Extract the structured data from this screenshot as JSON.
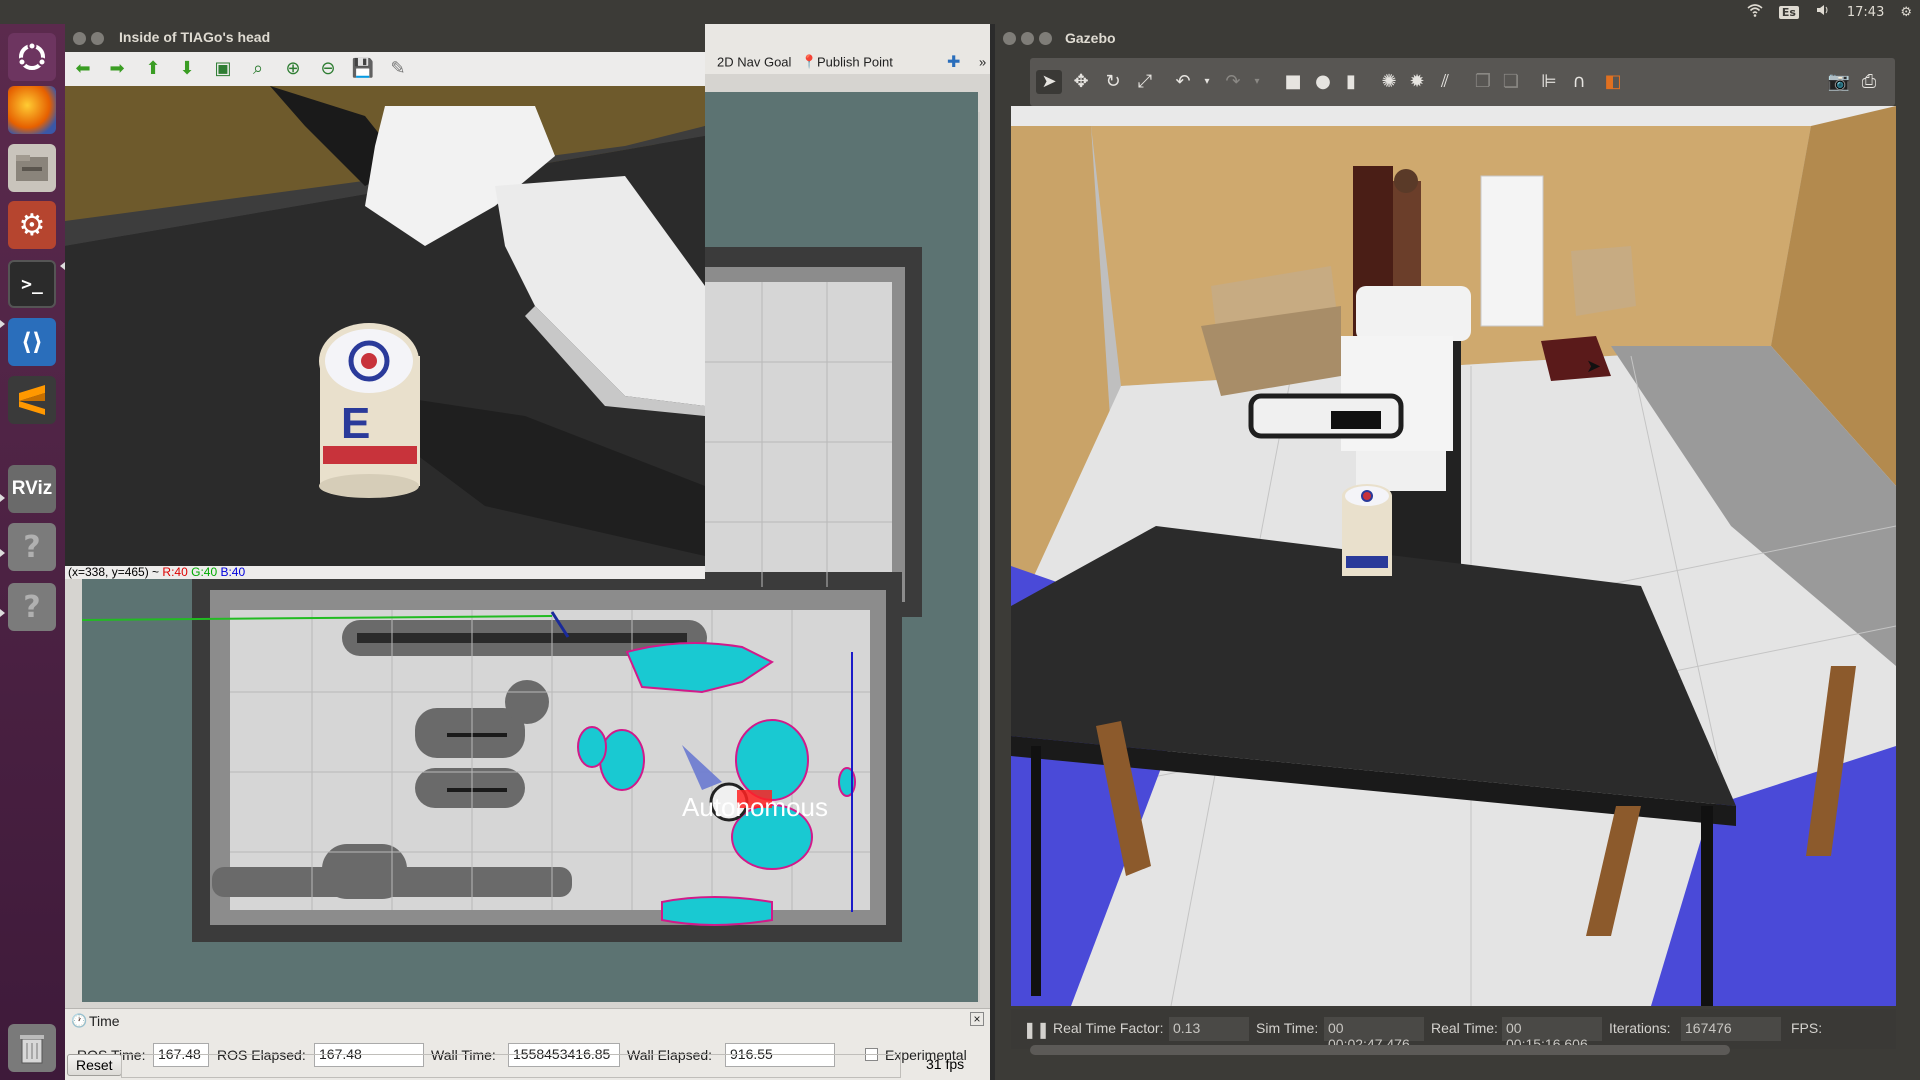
{
  "topbar": {
    "keyboard_layout": "Es",
    "time": "17:43"
  },
  "launcher": {
    "apps": [
      {
        "name": "ubuntu-dash",
        "label": ""
      },
      {
        "name": "firefox",
        "label": ""
      },
      {
        "name": "files",
        "label": ""
      },
      {
        "name": "system-settings",
        "label": ""
      },
      {
        "name": "terminal",
        "label": ""
      },
      {
        "name": "vscode",
        "label": ""
      },
      {
        "name": "sublime",
        "label": ""
      },
      {
        "name": "rviz",
        "label": "RViz"
      },
      {
        "name": "unknown-1",
        "label": "?"
      },
      {
        "name": "unknown-2",
        "label": "?"
      }
    ]
  },
  "imgwin": {
    "title": "Inside of TIAGo's head",
    "status_prefix": "(x=338, y=465) ~ ",
    "status_r": "R:40",
    "status_g": "G:40",
    "status_b": "B:40"
  },
  "rviz": {
    "toolbar": {
      "nav_goal": "2D Nav Goal",
      "publish_point": "Publish Point",
      "more": "»"
    },
    "map_label": "Autonomous",
    "time_panel": {
      "title": "Time",
      "ros_time_label": "ROS Time:",
      "ros_time": "167.48",
      "ros_elapsed_label": "ROS Elapsed:",
      "ros_elapsed": "167.48",
      "wall_time_label": "Wall Time:",
      "wall_time": "1558453416.85",
      "wall_elapsed_label": "Wall Elapsed:",
      "wall_elapsed": "916.55",
      "experimental_label": "Experimental",
      "reset_label": "Reset",
      "fps": "31 fps"
    }
  },
  "gazebo": {
    "title": "Gazebo",
    "status": {
      "rtf_label": "Real Time Factor:",
      "rtf": "0.13",
      "sim_time_label": "Sim Time:",
      "sim_time": "00 00:02:47.476",
      "real_time_label": "Real Time:",
      "real_time": "00 00:15:16.606",
      "iterations_label": "Iterations:",
      "iterations": "167476",
      "fps_label": "FPS:"
    }
  }
}
